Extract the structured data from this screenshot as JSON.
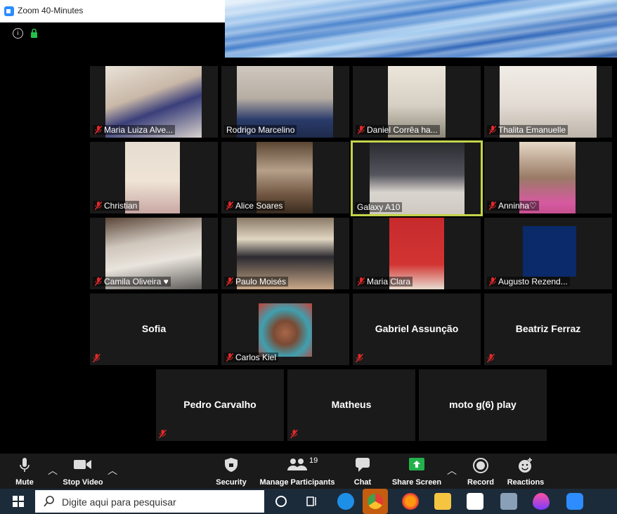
{
  "window": {
    "title": "Zoom 40-Minutes"
  },
  "colors": {
    "active_border": "#c4d44a",
    "muted_red": "#e02828",
    "toolbar_bg": "#1a1a1a",
    "share_green": "#22b24c",
    "taskbar_bg": "#1c2b3a"
  },
  "participants": [
    {
      "name": "Maria Luiza Alve...",
      "muted": true,
      "video": true
    },
    {
      "name": "Rodrigo Marcelino",
      "muted": false,
      "video": true
    },
    {
      "name": "Daniel Corrêa ha...",
      "muted": true,
      "video": true
    },
    {
      "name": "Thalita Emanuelle",
      "muted": true,
      "video": true
    },
    {
      "name": "Christian",
      "muted": true,
      "video": true
    },
    {
      "name": "Alice Soares",
      "muted": true,
      "video": true
    },
    {
      "name": "Galaxy A10",
      "muted": false,
      "video": true,
      "active_speaker": true
    },
    {
      "name": "Anninha♡",
      "muted": true,
      "video": true
    },
    {
      "name": "Camila Oliveira ♥",
      "muted": true,
      "video": true
    },
    {
      "name": "Paulo Moisés",
      "muted": true,
      "video": true
    },
    {
      "name": "Maria Clara",
      "muted": true,
      "video": true
    },
    {
      "name": "Augusto Rezend...",
      "muted": true,
      "video": true
    },
    {
      "name": "Sofia",
      "muted": true,
      "video": false
    },
    {
      "name": "Carlos Kiel",
      "muted": true,
      "video": true
    },
    {
      "name": "Gabriel Assunção",
      "muted": true,
      "video": false
    },
    {
      "name": "Beatriz Ferraz",
      "muted": true,
      "video": false
    },
    {
      "name": "Pedro Carvalho",
      "muted": true,
      "video": false
    },
    {
      "name": "Matheus",
      "muted": true,
      "video": false
    },
    {
      "name": "moto g(6) play",
      "muted": true,
      "video": false
    }
  ],
  "toolbar": {
    "mute": "Mute",
    "stop_video": "Stop Video",
    "security": "Security",
    "manage_participants": "Manage Participants",
    "participant_count": "19",
    "chat": "Chat",
    "share_screen": "Share Screen",
    "record": "Record",
    "reactions": "Reactions"
  },
  "taskbar": {
    "search_placeholder": "Digite aqui para pesquisar",
    "icons": [
      "cortana-icon",
      "task-view-icon",
      "edge-icon",
      "chrome-icon",
      "firefox-icon",
      "file-explorer-icon",
      "store-icon",
      "photos-icon",
      "drops-icon",
      "zoom-icon"
    ]
  }
}
